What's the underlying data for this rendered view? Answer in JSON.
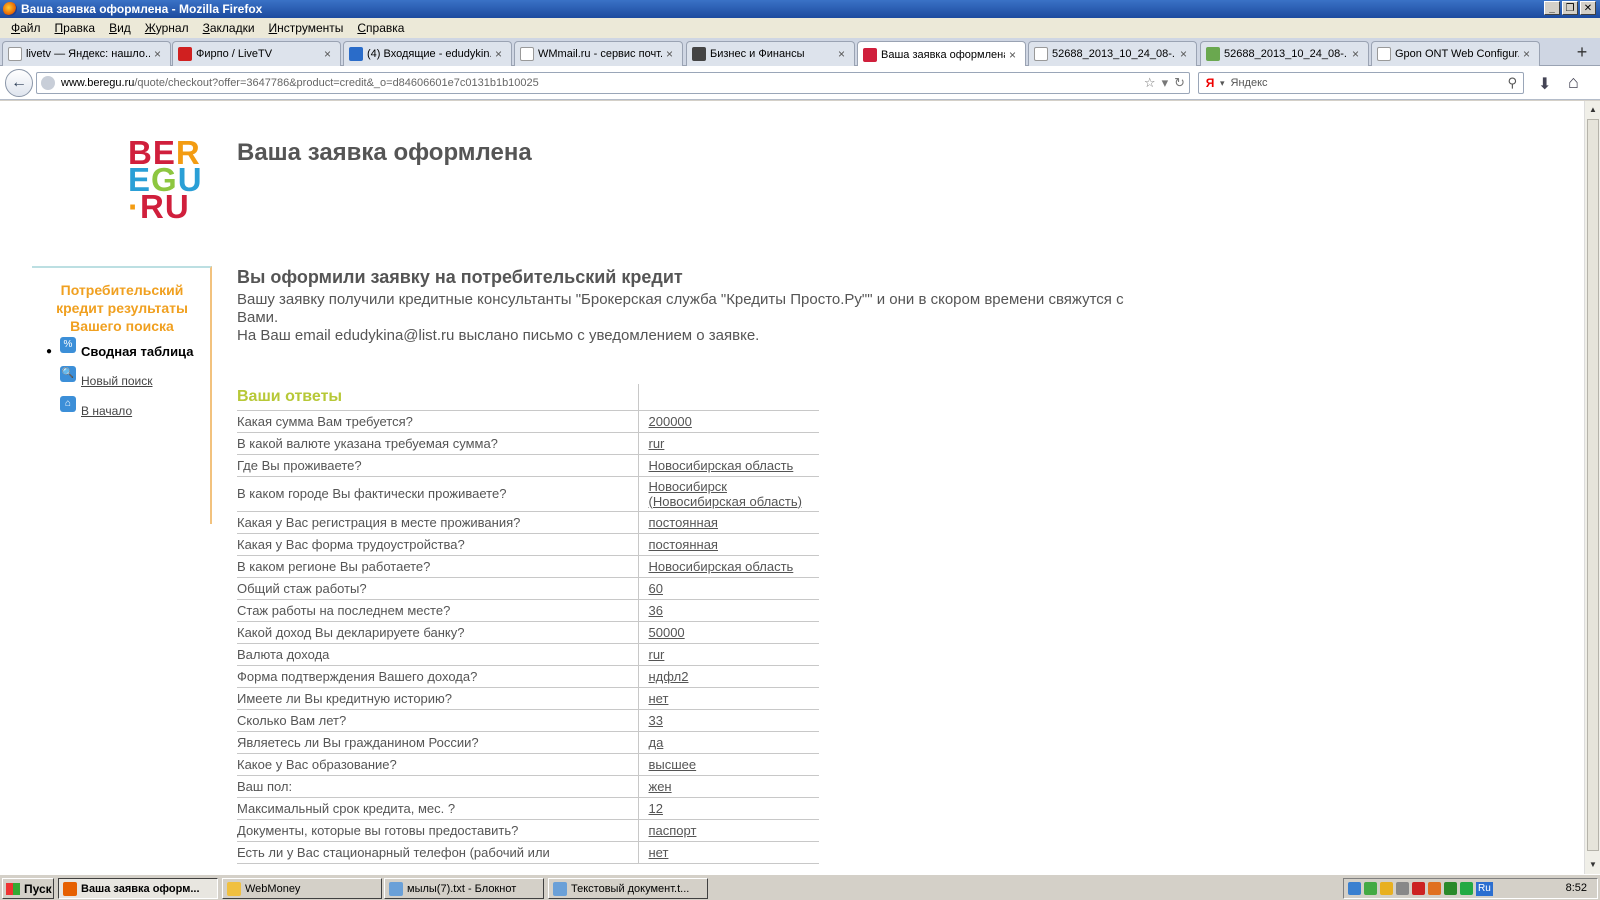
{
  "window": {
    "title": "Ваша заявка оформлена - Mozilla Firefox"
  },
  "menu": [
    "Файл",
    "Правка",
    "Вид",
    "Журнал",
    "Закладки",
    "Инструменты",
    "Справка"
  ],
  "tabs": [
    {
      "label": "livetv — Яндекс: нашло...",
      "icon": "yandex-icon",
      "color": "#ffffff"
    },
    {
      "label": "Фирпо / LiveTV",
      "icon": "livetv-icon",
      "color": "#d02020"
    },
    {
      "label": "(4) Входящие - edudykin...",
      "icon": "mail-icon",
      "color": "#2a6cc9"
    },
    {
      "label": "WMmail.ru - сервис почт...",
      "icon": "page-icon",
      "color": "#ffffff"
    },
    {
      "label": "Бизнес и Финансы",
      "icon": "finance-icon",
      "color": "#444444"
    },
    {
      "label": "Ваша заявка оформлена",
      "icon": "beregu-icon",
      "color": "#d01f3c",
      "active": true
    },
    {
      "label": "52688_2013_10_24_08-...",
      "icon": "page-icon",
      "color": "#ffffff"
    },
    {
      "label": "52688_2013_10_24_08-...",
      "icon": "image-icon",
      "color": "#6aa84f"
    },
    {
      "label": "Gpon ONT Web Configur...",
      "icon": "page-icon",
      "color": "#ffffff"
    }
  ],
  "nav": {
    "url_host": "www.beregu.ru",
    "url_rest": "/quote/checkout?offer=3647786&product=credit&_o=d84606601e7c0131b1b10025",
    "search_placeholder": "Яндекс"
  },
  "page": {
    "logo_lines": [
      [
        {
          "t": "B",
          "c": "#d01f3c"
        },
        {
          "t": "E",
          "c": "#d01f3c"
        },
        {
          "t": "R",
          "c": "#f39c12"
        }
      ],
      [
        {
          "t": "E",
          "c": "#2a9fd6"
        },
        {
          "t": "G",
          "c": "#8dc63f"
        },
        {
          "t": "U",
          "c": "#2a9fd6"
        }
      ],
      [
        {
          "t": "·",
          "c": "#f39c12"
        },
        {
          "t": "R",
          "c": "#d01f3c"
        },
        {
          "t": "U",
          "c": "#d01f3c"
        }
      ]
    ],
    "title": "Ваша заявка оформлена",
    "sidebar": {
      "title": "Потребительский кредит результаты Вашего поиска",
      "items": [
        {
          "label": "Сводная таблица",
          "icon": "percent-icon",
          "glyph": "%",
          "current": true
        },
        {
          "label": "Новый поиск",
          "icon": "search-icon",
          "glyph": "🔍",
          "current": false
        },
        {
          "label": "В начало",
          "icon": "home-icon",
          "glyph": "⌂",
          "current": false
        }
      ]
    },
    "heading": "Вы оформили заявку на потребительский кредит",
    "desc1": "Вашу заявку получили кредитные консультанты \"Брокерская служба \"Кредиты Просто.Ру\"\" и они в скором времени свяжутся с Вами.",
    "desc2": "На Ваш email edudykina@list.ru выслано письмо с уведомлением о заявке.",
    "answers_header": "Ваши ответы",
    "answers": [
      {
        "q": "Какая сумма Вам требуется?",
        "a": "200000"
      },
      {
        "q": "В какой валюте указана требуемая сумма?",
        "a": "rur"
      },
      {
        "q": "Где Вы проживаете?",
        "a": "Новосибирская область"
      },
      {
        "q": "В каком городе Вы фактически проживаете?",
        "a": "Новосибирск (Новосибирская область)"
      },
      {
        "q": "Какая у Вас регистрация в месте проживания?",
        "a": "постоянная"
      },
      {
        "q": "Какая у Вас форма трудоустройства?",
        "a": "постоянная"
      },
      {
        "q": "В каком регионе Вы работаете?",
        "a": "Новосибирская область"
      },
      {
        "q": "Общий стаж работы?",
        "a": "60"
      },
      {
        "q": "Стаж работы на последнем месте?",
        "a": "36"
      },
      {
        "q": "Какой доход Вы декларируете банку?",
        "a": "50000"
      },
      {
        "q": "Валюта дохода",
        "a": "rur"
      },
      {
        "q": "Форма подтверждения Вашего дохода?",
        "a": "ндфл2"
      },
      {
        "q": "Имеете ли Вы кредитную историю?",
        "a": "нет"
      },
      {
        "q": "Сколько Вам лет?",
        "a": "33"
      },
      {
        "q": "Являетесь ли Вы гражданином России?",
        "a": "да"
      },
      {
        "q": "Какое у Вас образование?",
        "a": "высшее"
      },
      {
        "q": "Ваш пол:",
        "a": "жен"
      },
      {
        "q": "Максимальный срок кредита, мес. ?",
        "a": "12"
      },
      {
        "q": "Документы, которые вы готовы предоставить?",
        "a": "паспорт"
      },
      {
        "q": "Есть ли у Вас стационарный телефон (рабочий или",
        "a": "нет"
      }
    ]
  },
  "taskbar": {
    "start": "Пуск",
    "buttons": [
      {
        "label": "Ваша заявка оформ...",
        "icon": "firefox-icon",
        "color": "#e66000",
        "active": true
      },
      {
        "label": "WebMoney",
        "icon": "folder-icon",
        "color": "#f0c040",
        "active": false
      },
      {
        "label": "мылы(7).txt - Блокнот",
        "icon": "notepad-icon",
        "color": "#6aa0d8",
        "active": false
      },
      {
        "label": "Текстовый документ.t...",
        "icon": "notepad-icon",
        "color": "#6aa0d8",
        "active": false
      }
    ],
    "tray_colors": [
      "#3a80d0",
      "#44aa44",
      "#e8b020",
      "#888888",
      "#cc2222",
      "#e07020",
      "#2a8a2a",
      "#22aa44"
    ],
    "lang": "Ru",
    "clock": "8:52"
  }
}
